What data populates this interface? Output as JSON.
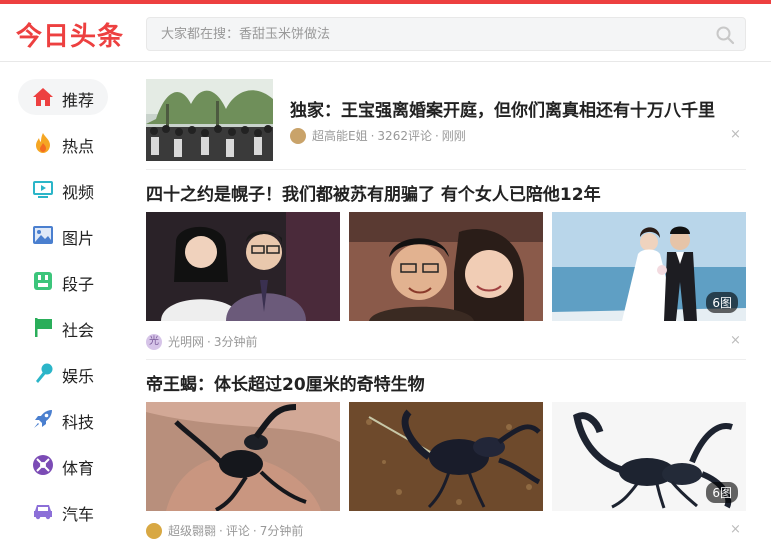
{
  "brand": {
    "logo_text": "今日头条",
    "accent": "#ed4040"
  },
  "search": {
    "placeholder": "大家都在搜：香甜玉米饼做法",
    "icon": "search-icon"
  },
  "sidebar": {
    "items": [
      {
        "label": "推荐",
        "icon": "home-icon",
        "active": true
      },
      {
        "label": "热点",
        "icon": "flame-icon"
      },
      {
        "label": "视频",
        "icon": "tv-icon"
      },
      {
        "label": "图片",
        "icon": "image-icon"
      },
      {
        "label": "段子",
        "icon": "jokes-icon"
      },
      {
        "label": "社会",
        "icon": "flag-icon"
      },
      {
        "label": "娱乐",
        "icon": "microphone-icon"
      },
      {
        "label": "科技",
        "icon": "rocket-icon"
      },
      {
        "label": "体育",
        "icon": "sports-icon"
      },
      {
        "label": "汽车",
        "icon": "car-icon"
      }
    ]
  },
  "feed": [
    {
      "title": "独家：王宝强离婚案开庭，但你们离真相还有十万八千里",
      "source": "超高能E姐",
      "comments": "3262评论",
      "time": "刚刚",
      "close": "×"
    },
    {
      "title": "四十之约是幌子！我们都被苏有朋骗了 有个女人已陪他12年",
      "source": "光明网",
      "source_avatar": "光",
      "time": "3分钟前",
      "image_count": "6图",
      "close": "×"
    },
    {
      "title": "帝王蝎：体长超过20厘米的奇特生物",
      "source": "超级翾翾",
      "comments": "评论",
      "time": "7分钟前",
      "image_count": "6图",
      "close": "×"
    }
  ]
}
